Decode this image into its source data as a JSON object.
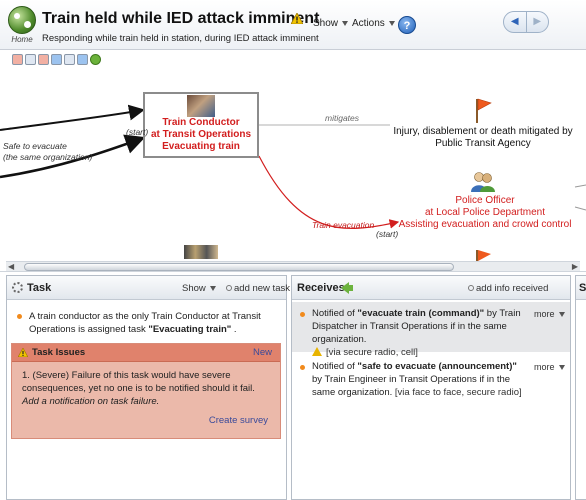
{
  "header": {
    "home_label": "Home",
    "title": "Train held while IED attack imminent",
    "subtitle": "Responding while train held in station, during IED attack imminent",
    "show_label": "Show",
    "actions_label": "Actions",
    "help_label": "?"
  },
  "canvas": {
    "conductor_label": "Train Conductor\nat Transit Operations\nEvacuating train",
    "officer_label": "Police Officer\nat Local Police Department\nAssisting evacuation and crowd control",
    "risk_label": "Injury, disablement or death mitigated by\nPublic Transit Agency",
    "edge_mitigates": "mitigates",
    "edge_safe_to_evacuate": "Safe to evacuate\n(the same organization)",
    "edge_start_1": "(start)",
    "edge_train_evacuation": "Train evacuation",
    "edge_start_2": "(start)",
    "accent_red": "#d21e1e"
  },
  "task_panel": {
    "title": "Task",
    "show_label": "Show",
    "add_label": "add new task",
    "description_pre": "A train conductor as the only Train Conductor at Transit Operations is assigned task ",
    "task_name": "\"Evacuating train\"",
    "description_post": " .",
    "issues": {
      "title": "Task Issues",
      "new_label": "New",
      "issue_text": "1. (Severe) Failure of this task would have severe consequences, yet no one is to be notified should it fail. ",
      "issue_suggestion": "Add a notification on task failure.",
      "create_survey": "Create survey"
    }
  },
  "receives_panel": {
    "title": "Receives",
    "add_label": "add info received",
    "items": [
      {
        "prefix": "Notified of ",
        "info": "\"evacuate train (command)\"",
        "suffix": " by Train Dispatcher in Transit Operations if in the same organization.",
        "via": "[via secure radio, cell]",
        "more": "more"
      },
      {
        "prefix": "Notified of ",
        "info": "\"safe to evacuate (announcement)\"",
        "suffix": " by Train Engineer in Transit Operations if in the same organization. ",
        "via": "[via face to face, secure radio]",
        "more": "more"
      }
    ]
  },
  "side_panel": {
    "title_letter": "S"
  }
}
